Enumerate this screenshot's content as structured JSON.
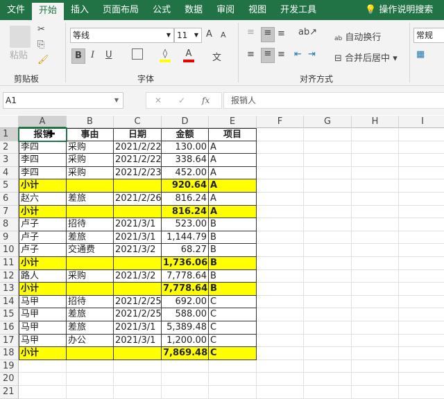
{
  "tabs": [
    "文件",
    "开始",
    "插入",
    "页面布局",
    "公式",
    "数据",
    "审阅",
    "视图",
    "开发工具"
  ],
  "active_tab": 1,
  "search_label": "操作说明搜索",
  "clipboard": {
    "paste": "粘贴",
    "label": "剪贴板"
  },
  "font": {
    "name": "等线",
    "size": "11",
    "label": "字体",
    "bold": "B",
    "italic": "I",
    "underline": "U",
    "grow": "A",
    "shrink": "A",
    "color_a": "A",
    "phonetic": "文"
  },
  "align": {
    "wrap": "自动换行",
    "merge": "合并后居中",
    "label": "对齐方式"
  },
  "number": {
    "format": "常规"
  },
  "formula_bar": {
    "name_box": "A1",
    "fx": "fx",
    "content": "报销人"
  },
  "columns": [
    "A",
    "B",
    "C",
    "D",
    "E",
    "F",
    "G",
    "H",
    "I"
  ],
  "colors": {
    "highlight": "#ffff00",
    "brand": "#217346"
  },
  "rows": [
    {
      "n": "1",
      "cells": [
        "报销",
        "事由",
        "日期",
        "金额",
        "项目"
      ],
      "header": true
    },
    {
      "n": "2",
      "cells": [
        "李四",
        "采购",
        "2021/2/22",
        "130.00",
        "A"
      ]
    },
    {
      "n": "3",
      "cells": [
        "李四",
        "采购",
        "2021/2/22",
        "338.64",
        "A"
      ]
    },
    {
      "n": "4",
      "cells": [
        "李四",
        "采购",
        "2021/2/23",
        "452.00",
        "A"
      ]
    },
    {
      "n": "5",
      "cells": [
        "小计",
        "",
        "",
        "920.64",
        "A"
      ],
      "subtotal": true
    },
    {
      "n": "6",
      "cells": [
        "赵六",
        "差旅",
        "2021/2/26",
        "816.24",
        "A"
      ]
    },
    {
      "n": "7",
      "cells": [
        "小计",
        "",
        "",
        "816.24",
        "A"
      ],
      "subtotal": true
    },
    {
      "n": "8",
      "cells": [
        "卢子",
        "招待",
        "2021/3/1",
        "523.00",
        "B"
      ]
    },
    {
      "n": "9",
      "cells": [
        "卢子",
        "差旅",
        "2021/3/1",
        "1,144.79",
        "B"
      ]
    },
    {
      "n": "10",
      "cells": [
        "卢子",
        "交通费",
        "2021/3/2",
        "68.27",
        "B"
      ]
    },
    {
      "n": "11",
      "cells": [
        "小计",
        "",
        "",
        "1,736.06",
        "B"
      ],
      "subtotal": true
    },
    {
      "n": "12",
      "cells": [
        "路人",
        "采购",
        "2021/3/2",
        "7,778.64",
        "B"
      ]
    },
    {
      "n": "13",
      "cells": [
        "小计",
        "",
        "",
        "7,778.64",
        "B"
      ],
      "subtotal": true
    },
    {
      "n": "14",
      "cells": [
        "马甲",
        "招待",
        "2021/2/25",
        "692.00",
        "C"
      ]
    },
    {
      "n": "15",
      "cells": [
        "马甲",
        "差旅",
        "2021/2/25",
        "588.00",
        "C"
      ]
    },
    {
      "n": "16",
      "cells": [
        "马甲",
        "差旅",
        "2021/3/1",
        "5,389.48",
        "C"
      ]
    },
    {
      "n": "17",
      "cells": [
        "马甲",
        "办公",
        "2021/3/1",
        "1,200.00",
        "C"
      ]
    },
    {
      "n": "18",
      "cells": [
        "小计",
        "",
        "",
        "7,869.48",
        "C"
      ],
      "subtotal": true
    },
    {
      "n": "19",
      "cells": []
    },
    {
      "n": "20",
      "cells": []
    },
    {
      "n": "21",
      "cells": []
    }
  ]
}
